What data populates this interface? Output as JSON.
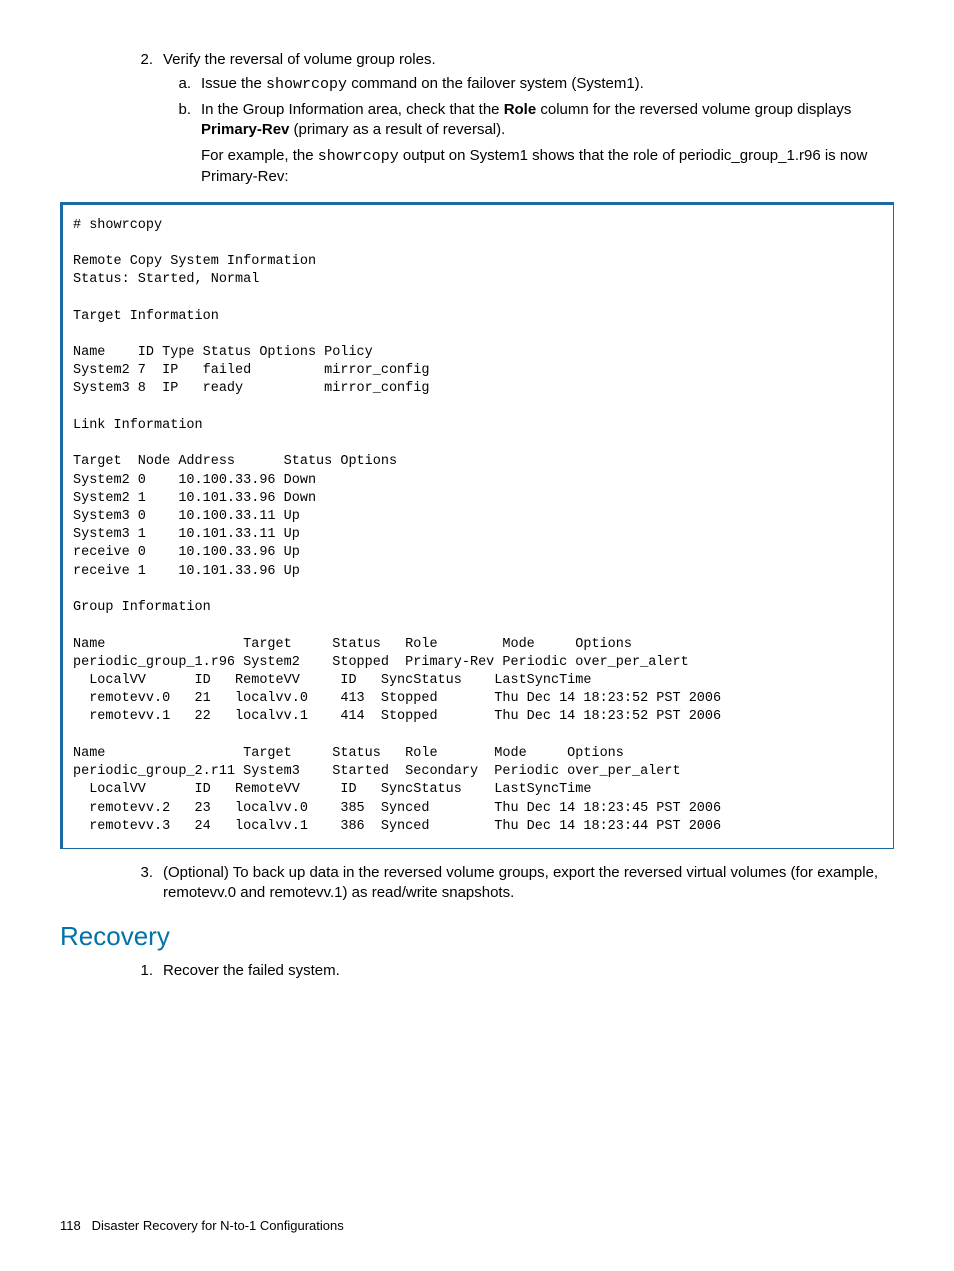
{
  "step2": {
    "num": "2.",
    "text": "Verify the reversal of volume group roles.",
    "a": {
      "let": "a.",
      "pre": "Issue the ",
      "cmd": "showrcopy",
      "post": " command on the failover system (System1)."
    },
    "b": {
      "let": "b.",
      "pre": "In the Group Information area, check that the ",
      "bold1": "Role",
      "mid": " column for the reversed volume group displays ",
      "bold2": "Primary-Rev",
      "post": " (primary as a result of reversal).",
      "eg_pre": "For example, the ",
      "eg_cmd": "showrcopy",
      "eg_post": " output on System1 shows that the role of periodic_group_1.r96 is now Primary-Rev:"
    }
  },
  "code": "# showrcopy\n\nRemote Copy System Information\nStatus: Started, Normal\n\nTarget Information\n\nName    ID Type Status Options Policy\nSystem2 7  IP   failed         mirror_config\nSystem3 8  IP   ready          mirror_config\n\nLink Information\n\nTarget  Node Address      Status Options\nSystem2 0    10.100.33.96 Down\nSystem2 1    10.101.33.96 Down\nSystem3 0    10.100.33.11 Up\nSystem3 1    10.101.33.11 Up\nreceive 0    10.100.33.96 Up\nreceive 1    10.101.33.96 Up\n\nGroup Information\n\nName                 Target     Status   Role        Mode     Options\nperiodic_group_1.r96 System2    Stopped  Primary-Rev Periodic over_per_alert\n  LocalVV      ID   RemoteVV     ID   SyncStatus    LastSyncTime\n  remotevv.0   21   localvv.0    413  Stopped       Thu Dec 14 18:23:52 PST 2006\n  remotevv.1   22   localvv.1    414  Stopped       Thu Dec 14 18:23:52 PST 2006\n\nName                 Target     Status   Role       Mode     Options\nperiodic_group_2.r11 System3    Started  Secondary  Periodic over_per_alert\n  LocalVV      ID   RemoteVV     ID   SyncStatus    LastSyncTime\n  remotevv.2   23   localvv.0    385  Synced        Thu Dec 14 18:23:45 PST 2006\n  remotevv.3   24   localvv.1    386  Synced        Thu Dec 14 18:23:44 PST 2006",
  "step3": {
    "num": "3.",
    "text": "(Optional) To back up data in the reversed volume groups, export the reversed virtual volumes (for example, remotevv.0 and remotevv.1) as read/write snapshots."
  },
  "recovery": {
    "title": "Recovery",
    "step1": {
      "num": "1.",
      "text": "Recover the failed system."
    }
  },
  "footer": {
    "page": "118",
    "title": "Disaster Recovery for N-to-1 Configurations"
  }
}
